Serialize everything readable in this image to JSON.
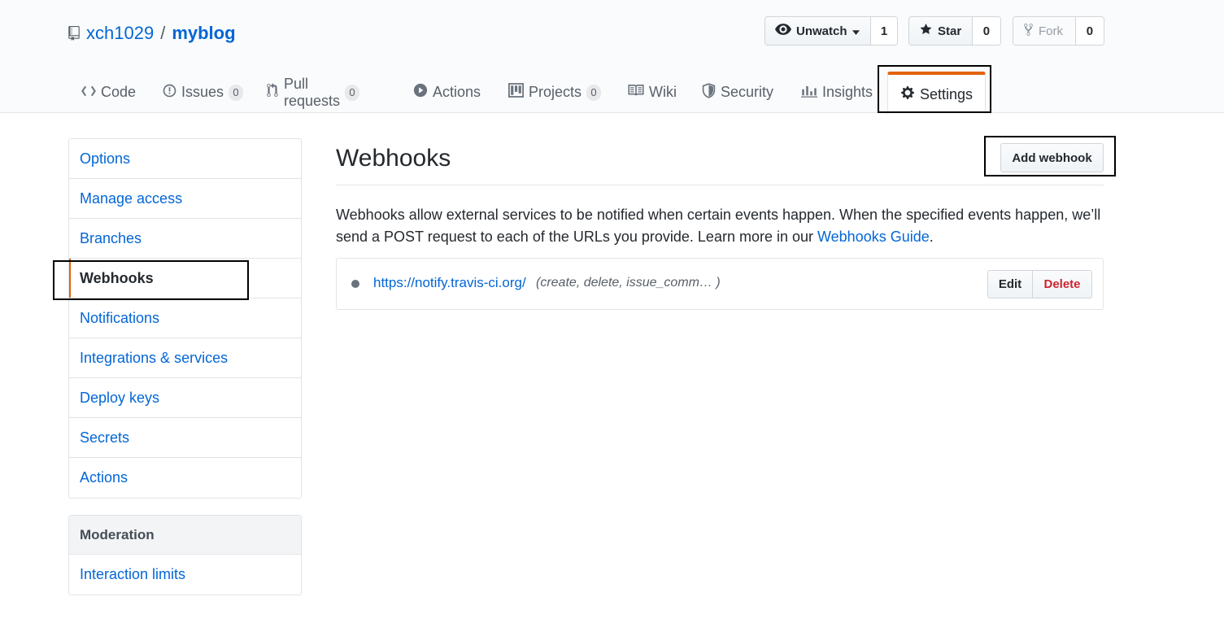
{
  "repo": {
    "owner": "xch1029",
    "separator": "/",
    "name": "myblog"
  },
  "actions": {
    "watch": {
      "label": "Unwatch",
      "count": "1"
    },
    "star": {
      "label": "Star",
      "count": "0"
    },
    "fork": {
      "label": "Fork",
      "count": "0"
    }
  },
  "tabs": [
    {
      "label": "Code"
    },
    {
      "label": "Issues",
      "count": "0"
    },
    {
      "label": "Pull requests",
      "count": "0"
    },
    {
      "label": "Actions"
    },
    {
      "label": "Projects",
      "count": "0"
    },
    {
      "label": "Wiki"
    },
    {
      "label": "Security"
    },
    {
      "label": "Insights"
    },
    {
      "label": "Settings"
    }
  ],
  "sidebar": {
    "items": [
      {
        "label": "Options"
      },
      {
        "label": "Manage access"
      },
      {
        "label": "Branches"
      },
      {
        "label": "Webhooks"
      },
      {
        "label": "Notifications"
      },
      {
        "label": "Integrations & services"
      },
      {
        "label": "Deploy keys"
      },
      {
        "label": "Secrets"
      },
      {
        "label": "Actions"
      }
    ],
    "moderation": {
      "heading": "Moderation",
      "items": [
        {
          "label": "Interaction limits"
        }
      ]
    }
  },
  "main": {
    "title": "Webhooks",
    "add_button": "Add webhook",
    "description": "Webhooks allow external services to be notified when certain events happen. When the specified events happen, we’ll send a POST request to each of the URLs you provide. Learn more in our ",
    "guide_link": "Webhooks Guide",
    "description_end": ".",
    "hooks": [
      {
        "url": "https://notify.travis-ci.org/",
        "events": "(create, delete, issue_comm… )",
        "edit_label": "Edit",
        "delete_label": "Delete"
      }
    ]
  },
  "colors": {
    "link": "#0366d6",
    "accent": "#e36209",
    "danger": "#cb2431"
  }
}
